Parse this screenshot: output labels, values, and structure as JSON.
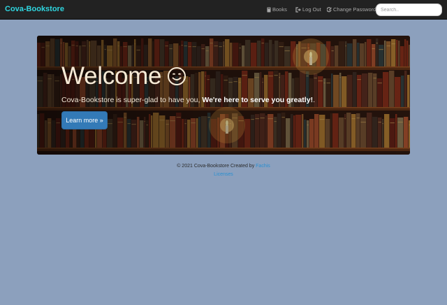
{
  "navbar": {
    "brand": "Cova-Bookstore",
    "links": [
      {
        "label": "Books",
        "icon": "book-icon"
      },
      {
        "label": "Log Out",
        "icon": "logout-icon"
      },
      {
        "label": "Change Password",
        "icon": "edit-icon"
      }
    ],
    "search_placeholder": "Search.."
  },
  "jumbotron": {
    "title": "Welcome",
    "emoji": "😊",
    "subtitle_plain": "Cova-Bookstore is super-glad to have you, ",
    "subtitle_bold": "We're here to serve you greatly!",
    "subtitle_end": ".",
    "button_label": "Learn more »"
  },
  "footer": {
    "copyright": "© 2021 Cova-Bookstore Created by",
    "author": "Fachis",
    "licenses": "Licenses"
  },
  "colors": {
    "navbar_bg": "#222222",
    "brand": "#2fd6e0",
    "page_bg": "#8ca0bd",
    "button": "#337ab7",
    "link": "#2a8fd0"
  }
}
